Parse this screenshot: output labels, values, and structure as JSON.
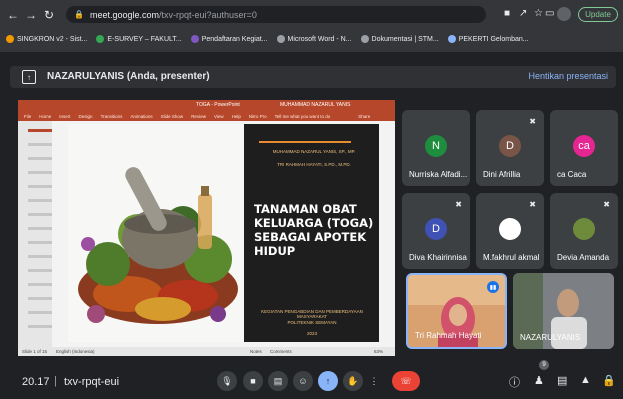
{
  "browser": {
    "url_host": "meet.google.com",
    "url_path": "/txv-rpqt-eui?authuser=0",
    "update_label": "Update",
    "bookmarks": [
      {
        "label": "SINGKRON v2 - Sist...",
        "color": "#f29900"
      },
      {
        "label": "E-SURVEY – FAKULT...",
        "color": "#34a853"
      },
      {
        "label": "Pendaftaran Kegiat...",
        "color": "#7e57c2"
      },
      {
        "label": "Microsoft Word - N...",
        "color": "#9aa0a6"
      },
      {
        "label": "Dokumentasi | STM...",
        "color": "#9aa0a6"
      },
      {
        "label": "PEKERTI Gelomban...",
        "color": "#8ab4f8"
      }
    ]
  },
  "presentation": {
    "presenter_label": "NAZARULYANIS (Anda, presenter)",
    "stop_label": "Hentikan presentasi"
  },
  "slide": {
    "app_title": "TOGA - PowerPoint",
    "account": "MUHAMMAD NAZARUL YANIS",
    "ribbon_tabs": [
      "File",
      "Home",
      "Insert",
      "Design",
      "Transitions",
      "Animations",
      "Slide Show",
      "Review",
      "View",
      "Help",
      "Nitro Pro",
      "Tell me what you want to do"
    ],
    "share_label": "Share",
    "authors": [
      "MUHAMMAD NAZARUL YANIS, SP., MP.",
      "TRI RAHMAH HAYATI, S.PD., M.PD."
    ],
    "title": "TANAMAN OBAT KELUARGA (TOGA) SEBAGAI APOTEK HIDUP",
    "footer": [
      "KEGIATAN PENGABDIAN DAN PEMBERDAYAAN MASYARAKAT",
      "POLITEKNIK SEMAYAN",
      "2023"
    ],
    "status_left": "Slide 1 of 15",
    "status_lang": "English (Indonesia)",
    "status_notes": "Notes",
    "status_comments": "Comments",
    "zoom": "63%"
  },
  "participants": [
    {
      "initial": "N",
      "name": "Nurriska Alfadi...",
      "color": "#1e8e3e",
      "muted": false
    },
    {
      "initial": "D",
      "name": "Dini Afrillia",
      "color": "#795548",
      "muted": true
    },
    {
      "initial": "ca",
      "name": "ca Caca",
      "color": "#e52592",
      "muted": false
    },
    {
      "initial": "D",
      "name": "Diva Khairinnisa",
      "color": "#3f51b5",
      "muted": true
    },
    {
      "initial": "",
      "name": "M.fakhrul akmal",
      "color": "#ffffff",
      "muted": true
    },
    {
      "initial": "",
      "name": "Devia Amanda",
      "color": "#6d8b3a",
      "muted": true
    }
  ],
  "video_tiles": [
    {
      "name": "Tri Rahmah Hayati"
    },
    {
      "name": "NAZARULYANIS"
    }
  ],
  "bottom": {
    "time": "20.17",
    "separator": "|",
    "meeting_code": "txv-rpqt-eui",
    "people_count": "9"
  }
}
